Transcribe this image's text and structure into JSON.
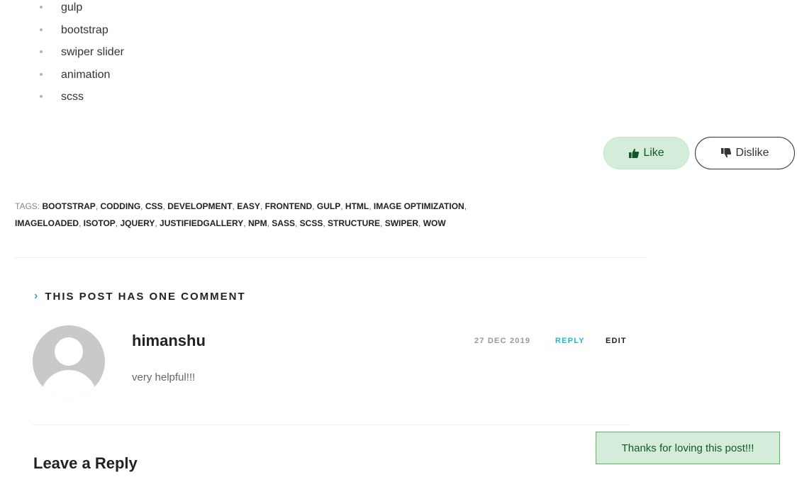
{
  "post": {
    "list_items": [
      "gulp",
      "bootstrap",
      "swiper slider",
      "animation",
      "scss"
    ],
    "like_label": "Like",
    "dislike_label": "Dislike",
    "tags_label": "TAGS:",
    "tags": [
      "BOOTSTRAP",
      "CODDING",
      "CSS",
      "DEVELOPMENT",
      "EASY",
      "FRONTEND",
      "GULP",
      "HTML",
      "IMAGE OPTIMIZATION",
      "IMAGELOADED",
      "ISOTOP",
      "JQUERY",
      "JUSTIFIEDGALLERY",
      "NPM",
      "SASS",
      "SCSS",
      "STRUCTURE",
      "SWIPER",
      "WOW"
    ]
  },
  "comments": {
    "title": "THIS POST HAS ONE COMMENT",
    "items": [
      {
        "author": "himanshu",
        "date": "27 DEC 2019",
        "reply_label": "REPLY",
        "edit_label": "EDIT",
        "text": "very helpful!!!"
      }
    ]
  },
  "reply_section": {
    "title": "Leave a Reply"
  },
  "toast": {
    "message": "Thanks for loving this post!!!"
  },
  "colors": {
    "accent": "#1eb6d3",
    "like_bg": "#d4edda",
    "like_text": "#155724"
  }
}
